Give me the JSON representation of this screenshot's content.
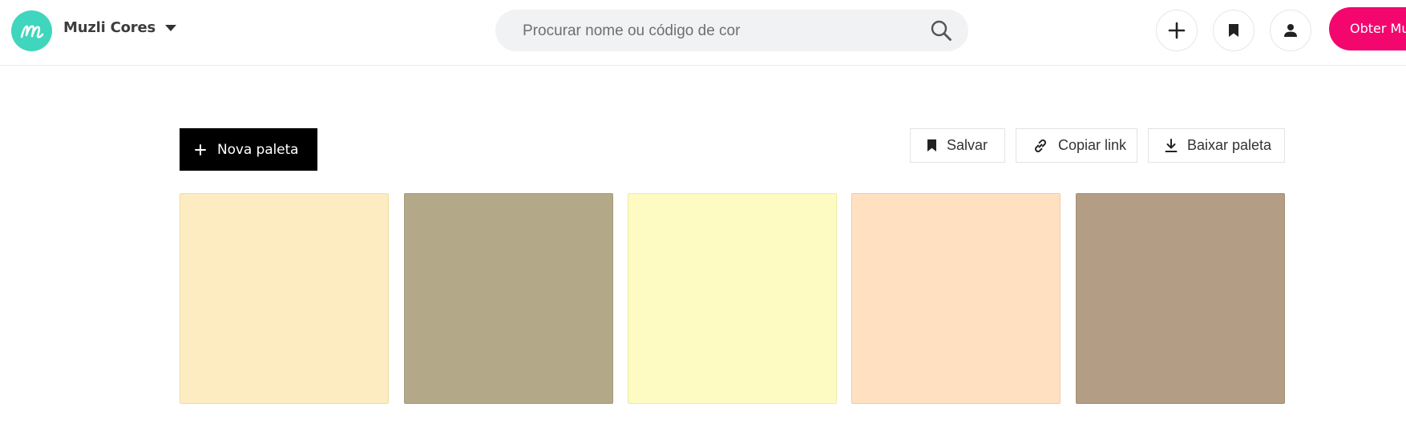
{
  "header": {
    "brand": "Muzli Cores",
    "search_placeholder": "Procurar nome ou código de cor",
    "buttons": [
      {
        "name": "add-button",
        "icon": "plus-icon"
      },
      {
        "name": "bookmarks-button",
        "icon": "bookmark-icon"
      },
      {
        "name": "profile-button",
        "icon": "user-icon"
      }
    ],
    "cta_label": "Obter Muzli",
    "cta_color": "#f3076f",
    "logo_color": "#3fd6bd"
  },
  "toolbar": {
    "new_palette_label": "Nova paleta",
    "save_label": "Salvar",
    "copy_link_label": "Copiar link",
    "download_label": "Baixar paleta"
  },
  "palette": {
    "swatches": [
      {
        "color": "#fdecc2",
        "border": "#efdca6"
      },
      {
        "color": "#b3a888",
        "border": "#a59a7b"
      },
      {
        "color": "#fdfbc1",
        "border": "#ecebaa"
      },
      {
        "color": "#ffe1c2",
        "border": "#ecccab"
      },
      {
        "color": "#b39e85",
        "border": "#a38f78"
      }
    ]
  }
}
